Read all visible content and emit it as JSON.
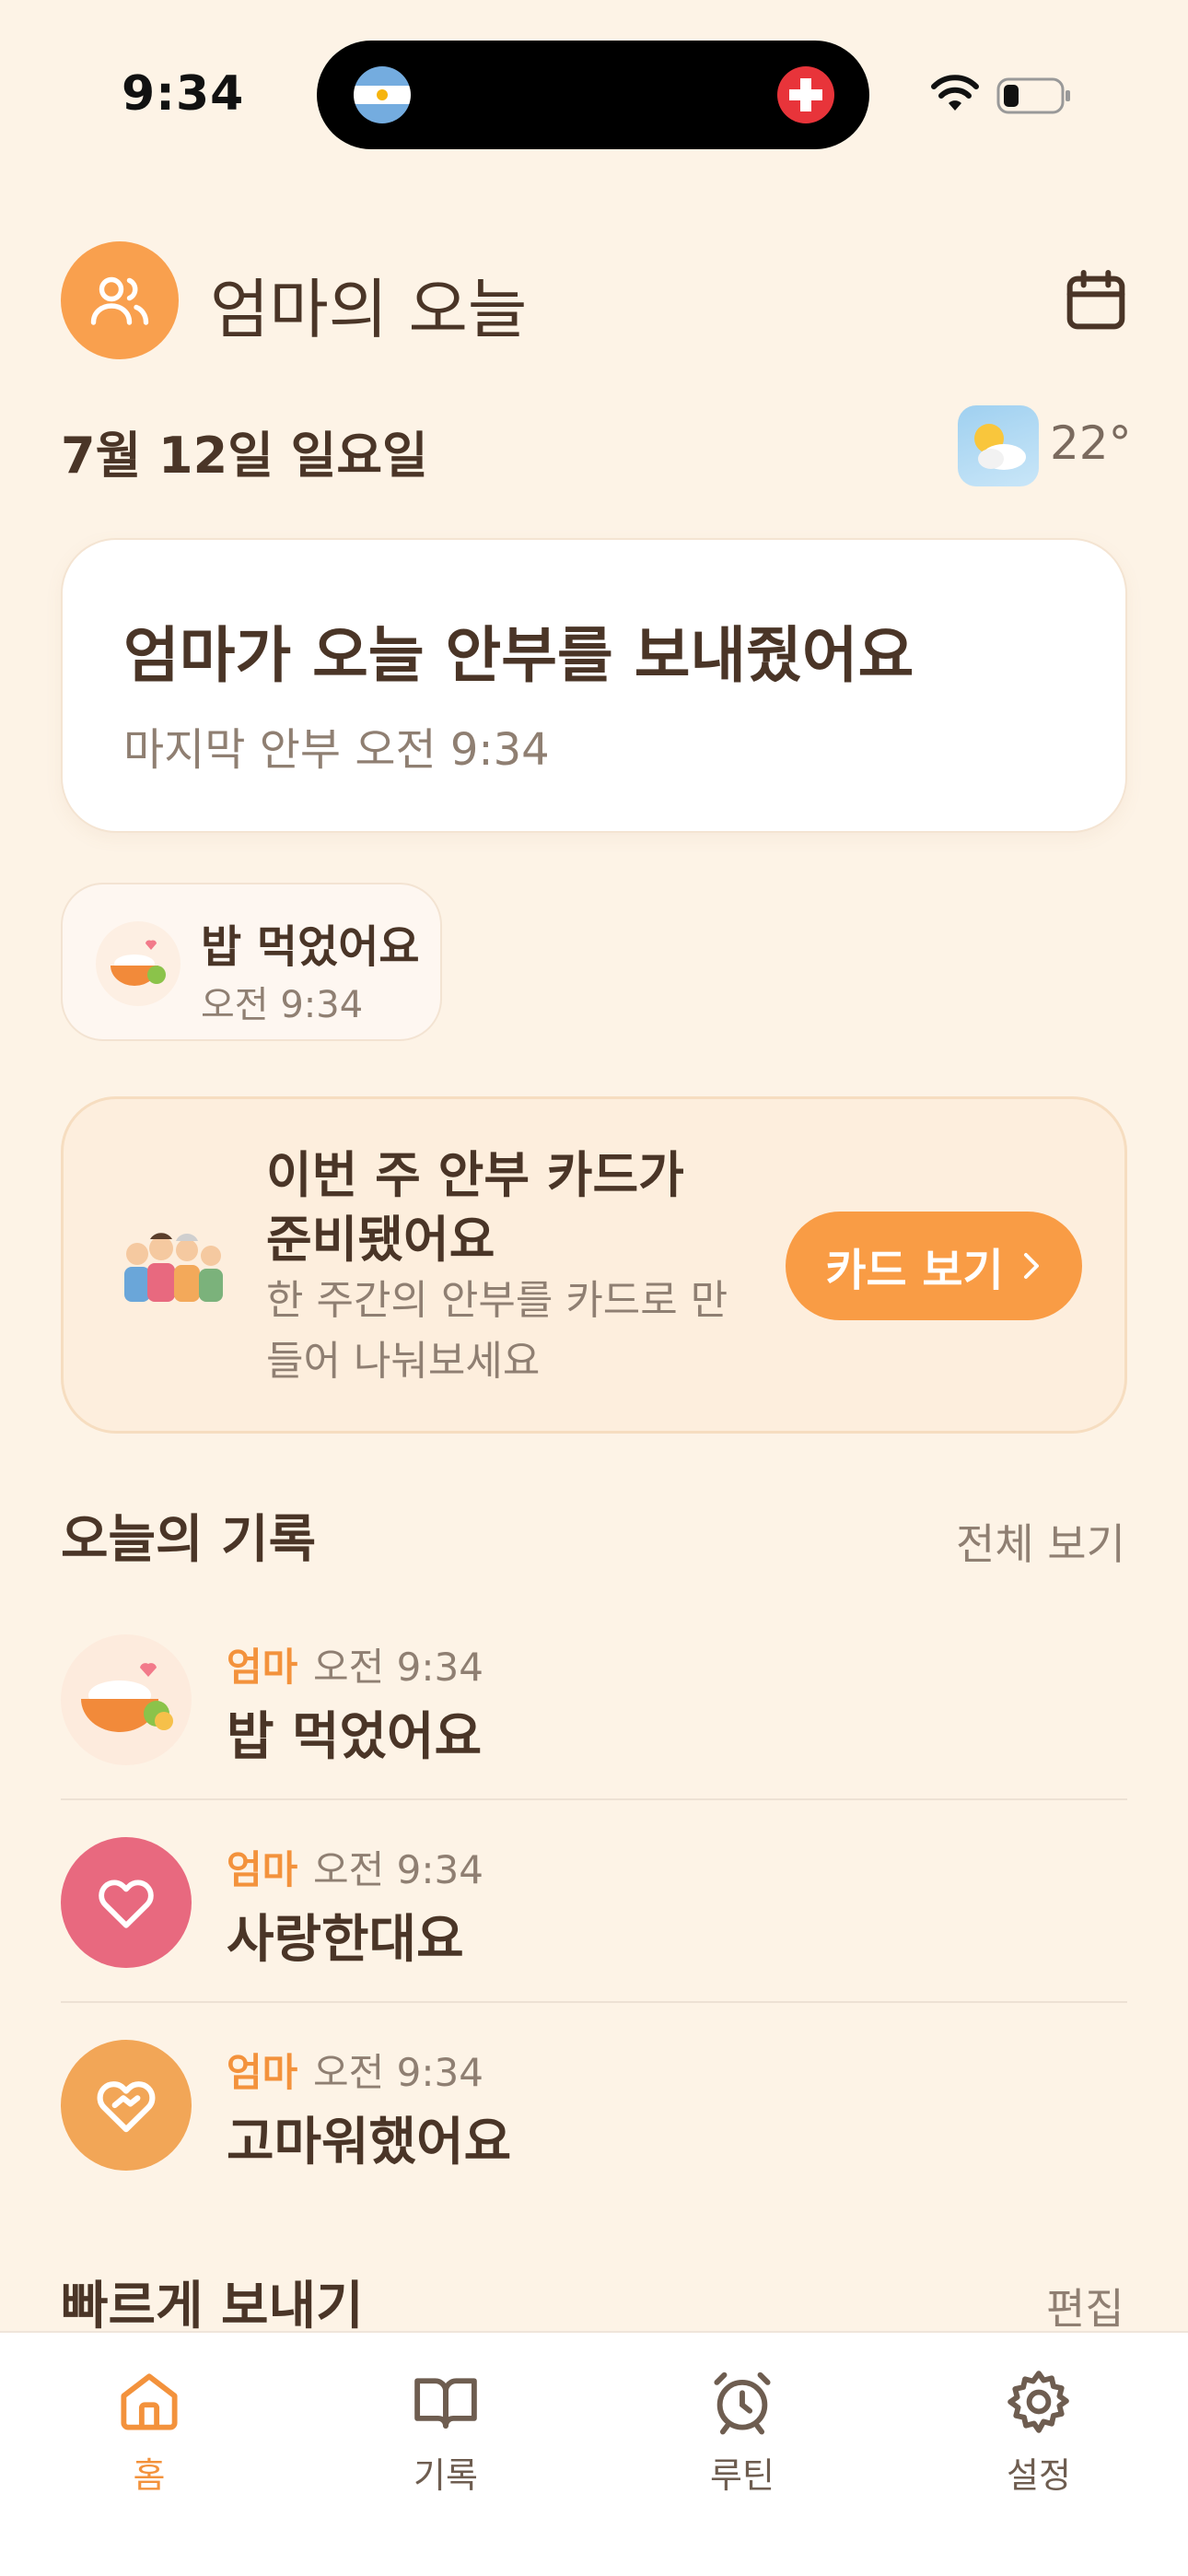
{
  "status_bar": {
    "time": "9:34"
  },
  "header": {
    "title": "엄마의 오늘",
    "avatar_icon": "people-icon",
    "calendar_icon": "calendar-icon"
  },
  "date_row": {
    "date": "7월 12일 일요일",
    "weather_icon": "partly-cloudy-icon",
    "temperature": "22°"
  },
  "status_card": {
    "headline": "엄마가 오늘 안부를 보내줬어요",
    "last_update": "마지막 안부 오전 9:34"
  },
  "latest_chip": {
    "icon": "rice-bowl-icon",
    "label": "밥 먹었어요",
    "time": "오전 9:34"
  },
  "promo": {
    "title": "이번 주 안부 카드가 준비됐어요",
    "description": "한 주간의 안부를 카드로 만들어 나눠보세요",
    "cta": "카드 보기",
    "cta_icon": "chevron-right-icon",
    "illustration": "family-illustration"
  },
  "records": {
    "title": "오늘의 기록",
    "view_all": "전체 보기",
    "items": [
      {
        "who": "엄마",
        "time": "오전 9:34",
        "text": "밥 먹었어요",
        "icon": "rice-bowl-icon"
      },
      {
        "who": "엄마",
        "time": "오전 9:34",
        "text": "사랑한대요",
        "icon": "heart-icon"
      },
      {
        "who": "엄마",
        "time": "오전 9:34",
        "text": "고마워했어요",
        "icon": "heart-hands-icon"
      }
    ]
  },
  "quick_send": {
    "title": "빠르게 보내기",
    "edit": "편집"
  },
  "tabs": [
    {
      "label": "홈",
      "icon": "home-icon",
      "active": true
    },
    {
      "label": "기록",
      "icon": "book-icon",
      "active": false
    },
    {
      "label": "루틴",
      "icon": "alarm-icon",
      "active": false
    },
    {
      "label": "설정",
      "icon": "gear-icon",
      "active": false
    }
  ],
  "colors": {
    "background": "#FDF3E6",
    "accent": "#F99C45",
    "text": "#4A3527",
    "muted": "#8F7F72",
    "love": "#E8697F"
  }
}
